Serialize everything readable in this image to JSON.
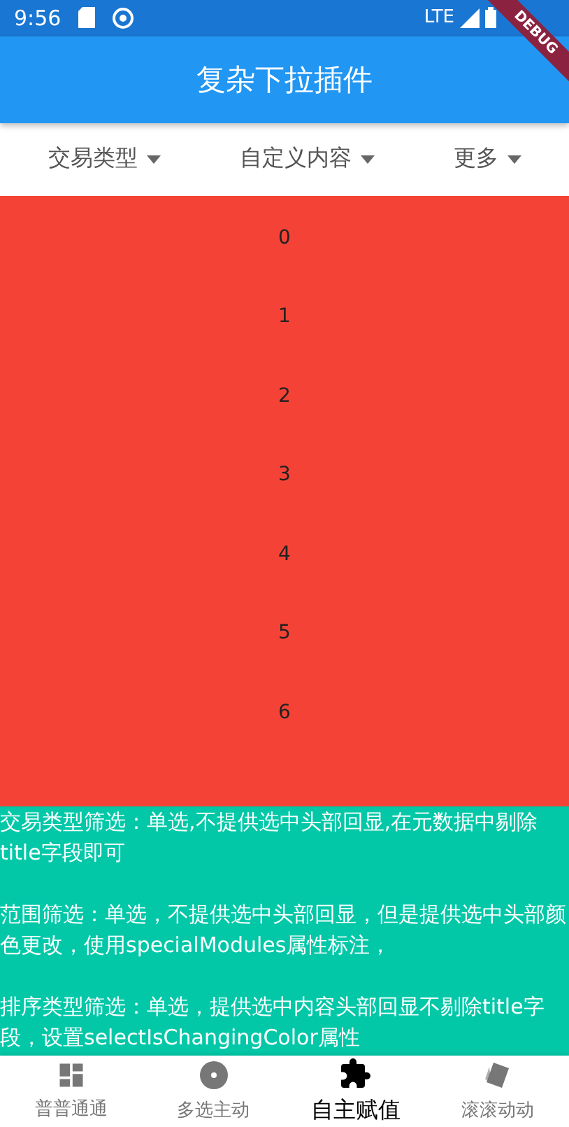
{
  "status_bar": {
    "time": "9:56",
    "network": "LTE"
  },
  "debug_banner": "DEBUG",
  "app_bar": {
    "title": "复杂下拉插件"
  },
  "filters": [
    {
      "label": "交易类型"
    },
    {
      "label": "自定义内容"
    },
    {
      "label": "更多"
    }
  ],
  "list": [
    "0",
    "1",
    "2",
    "3",
    "4",
    "5",
    "6"
  ],
  "notes": [
    "交易类型筛选：单选,不提供选中头部回显,在元数据中剔除title字段即可",
    "范围筛选：单选，不提供选中头部回显，但是提供选中头部颜色更改，使用specialModules属性标注，",
    "排序类型筛选：单选，提供选中内容头部回显不剔除title字段，设置selectIsChangingColor属性"
  ],
  "bottom_nav": [
    {
      "label": "普普通通",
      "selected": false
    },
    {
      "label": "多选主动",
      "selected": false
    },
    {
      "label": "自主赋值",
      "selected": true
    },
    {
      "label": "滚滚动动",
      "selected": false
    }
  ]
}
